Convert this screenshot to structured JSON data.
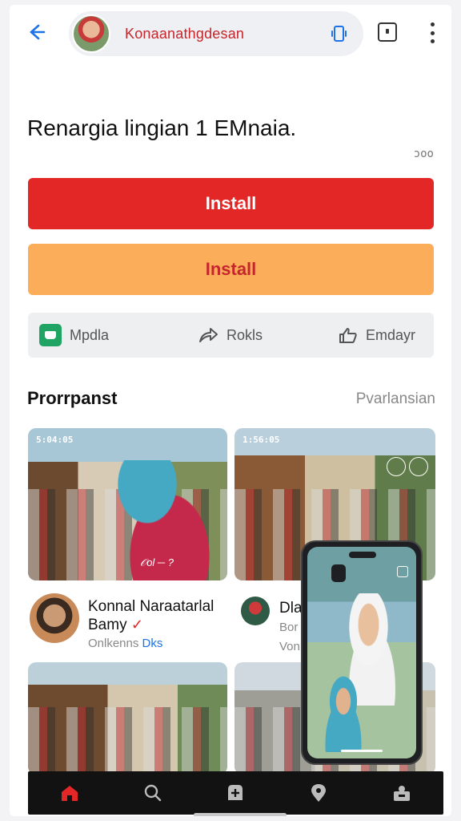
{
  "header": {
    "title": "Konaanathgdesan",
    "back_icon": "back-arrow-icon",
    "pill_action_icon": "phone-rotate-icon",
    "tabs_icon": "tab-switcher-icon",
    "menu_icon": "more-vert-icon"
  },
  "app": {
    "headline": "Renargia lingian 1 EMnaia.",
    "meta": "ɔoo",
    "primary_button": "Install",
    "secondary_button": "Install",
    "actions": [
      {
        "label": "Mpdla",
        "icon": "app-icon"
      },
      {
        "label": "Rokls",
        "icon": "share-icon"
      },
      {
        "label": "Emdayr",
        "icon": "thumb-up-icon"
      }
    ]
  },
  "section": {
    "title": "Prorrpanst",
    "link": "Pvarlansian"
  },
  "cards": [
    {
      "status": "5:04:05",
      "overlay_text": "𝒪ol ─ ?"
    },
    {
      "status": "1:56:05"
    }
  ],
  "authors": [
    {
      "name": "Konnal Naraatarlal Bamy",
      "sub_gray": "Onlkenns ",
      "sub_blue": "Dks"
    },
    {
      "name": "Dla",
      "sub1": "Bor",
      "sub2": "Von"
    }
  ],
  "colors": {
    "primary_red": "#e32626",
    "secondary_orange": "#fbad5a",
    "accent_blue": "#1e73e8",
    "nav_bg": "#121212"
  },
  "bottom_nav": [
    {
      "icon": "home-icon",
      "active": true
    },
    {
      "icon": "search-icon",
      "active": false
    },
    {
      "icon": "add-icon",
      "active": false
    },
    {
      "icon": "location-icon",
      "active": false
    },
    {
      "icon": "profile-icon",
      "active": false
    }
  ]
}
